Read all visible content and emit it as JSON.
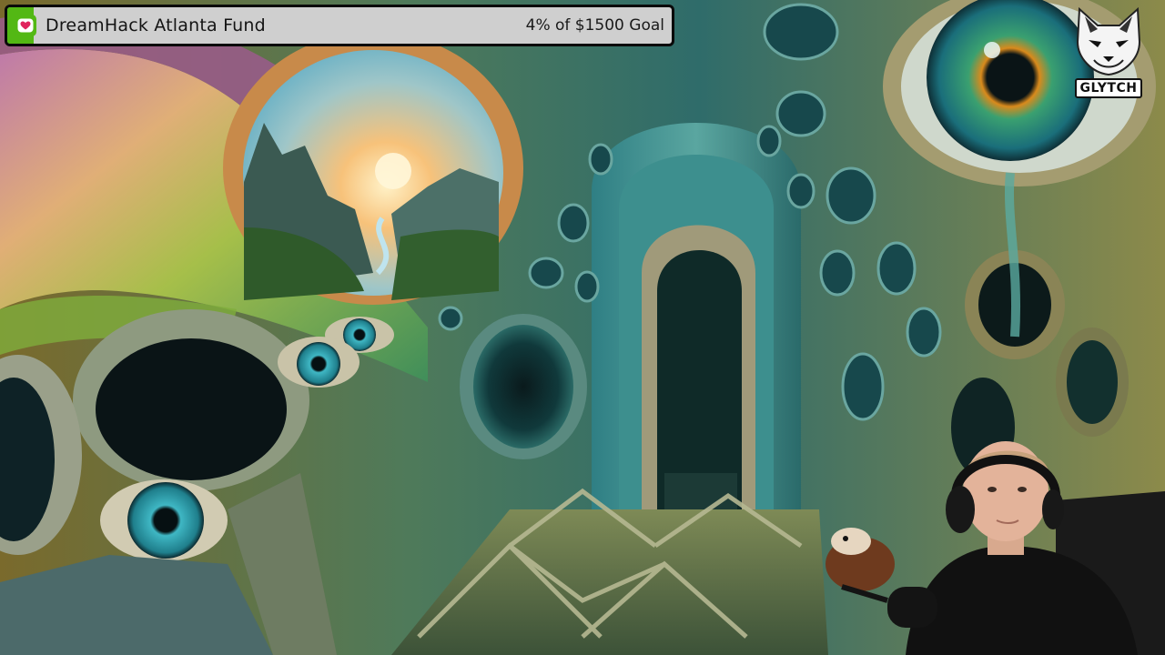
{
  "goal_widget": {
    "title": "DreamHack Atlanta Fund",
    "progress_text": "4% of $1500 Goal",
    "progress_fraction": 0.04,
    "icon": "donation-heart-icon",
    "colors": {
      "fill": "#53b814",
      "track": "#cfcfcf",
      "border": "#0a0a0a"
    }
  },
  "brand": {
    "label": "GLYTCH",
    "icon": "fox-mascot-icon"
  },
  "scene": {
    "icon": "surreal-eye-architecture-artwork"
  },
  "webcam": {
    "icon": "streamer-webcam-feed"
  }
}
